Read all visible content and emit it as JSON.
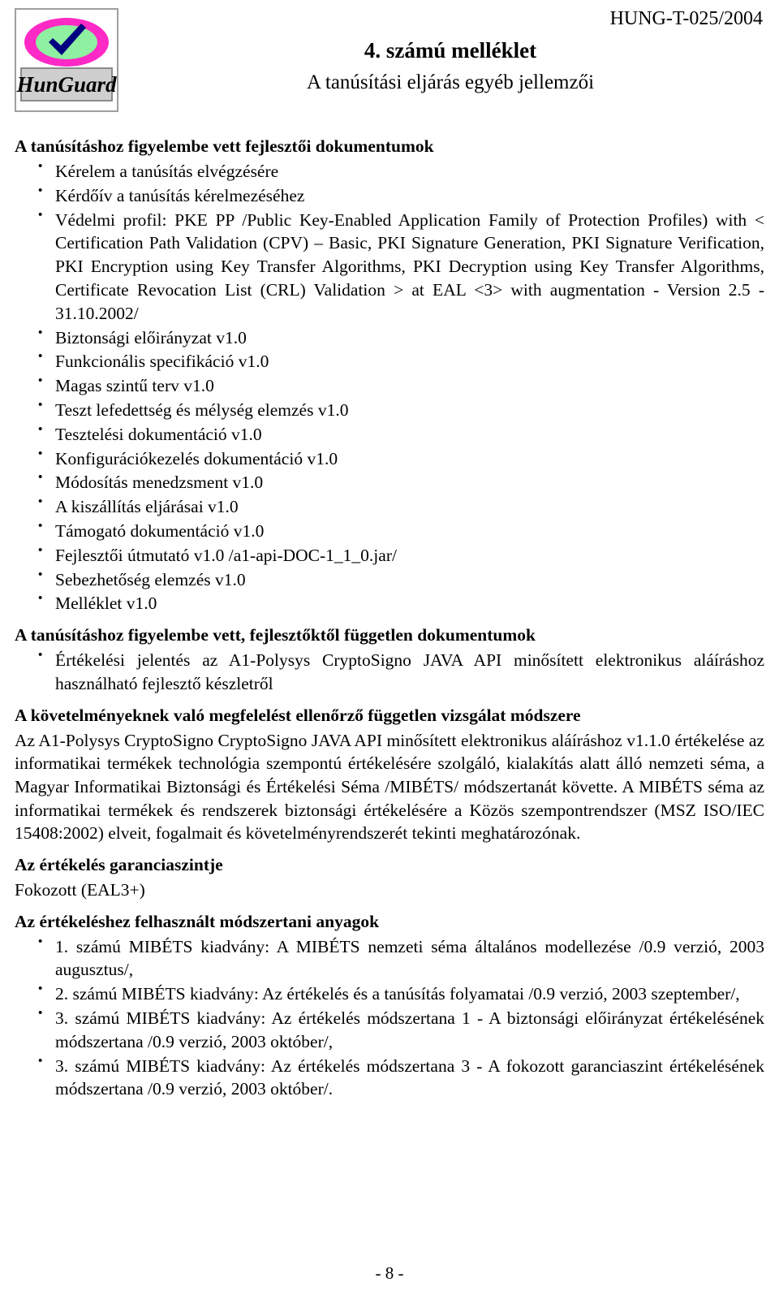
{
  "header": {
    "doc_code": "HUNG-T-025/2004",
    "title_main": "4. számú melléklet",
    "title_sub": "A tanúsítási eljárás egyéb jellemzői",
    "logo_alt": "HunGuard",
    "logo_text": "HunGuard"
  },
  "sections": {
    "dev_docs_heading": "A tanúsításhoz figyelembe vett fejlesztői dokumentumok",
    "dev_docs_items": [
      "Kérelem a tanúsítás elvégzésére",
      "Kérdőív a tanúsítás kérelmezéséhez",
      "Védelmi profil: PKE PP /Public Key-Enabled Application Family of Protection Profiles) with < Certification Path Validation (CPV) – Basic, PKI Signature Generation, PKI Signature Verification, PKI Encryption using Key Transfer Algorithms, PKI Decryption using Key Transfer Algorithms, Certificate Revocation List (CRL) Validation > at EAL <3> with augmentation - Version 2.5 - 31.10.2002/",
      "Biztonsági előirányzat v1.0",
      "Funkcionális specifikáció v1.0",
      "Magas szintű terv v1.0",
      "Teszt lefedettség és mélység elemzés v1.0",
      "Tesztelési dokumentáció v1.0",
      "Konfigurációkezelés dokumentáció v1.0",
      "Módosítás menedzsment v1.0",
      "A kiszállítás eljárásai v1.0",
      "Támogató dokumentáció v1.0",
      "Fejlesztői útmutató v1.0 /a1-api-DOC-1_1_0.jar/",
      "Sebezhetőség elemzés v1.0",
      "Melléklet v1.0"
    ],
    "independent_docs_heading": "A tanúsításhoz figyelembe vett, fejlesztőktől független dokumentumok",
    "independent_docs_items": [
      "Értékelési jelentés az A1-Polysys CryptoSigno JAVA API minősített elektronikus aláíráshoz használható fejlesztő készletről"
    ],
    "method_heading": "A követelményeknek való megfelelést ellenőrző független vizsgálat módszere",
    "method_paragraph": "Az A1-Polysys CryptoSigno CryptoSigno JAVA API minősített elektronikus aláíráshoz v1.1.0 értékelése az informatikai termékek technológia szempontú értékelésére szolgáló, kialakítás alatt álló nemzeti séma, a Magyar Informatikai Biztonsági és Értékelési Séma /MIBÉTS/ módszertanát követte. A MIBÉTS séma az informatikai termékek és rendszerek biztonsági értékelésére a Közös szempontrendszer (MSZ ISO/IEC 15408:2002) elveit, fogalmait és követelményrendszerét tekinti meghatározónak.",
    "assurance_heading": "Az értékelés garanciaszintje",
    "assurance_value": "Fokozott (EAL3+)",
    "materials_heading": "Az értékeléshez felhasznált módszertani anyagok",
    "materials_items": [
      "1. számú MIBÉTS kiadvány: A MIBÉTS nemzeti séma általános modellezése /0.9 verzió, 2003 augusztus/,",
      "2. számú MIBÉTS kiadvány: Az értékelés és a tanúsítás folyamatai /0.9 verzió, 2003 szeptember/,",
      "3. számú MIBÉTS kiadvány: Az értékelés módszertana 1 - A biztonsági előirányzat értékelésének módszertana /0.9 verzió, 2003 október/,",
      "3. számú MIBÉTS kiadvány: Az értékelés módszertana 3 - A fokozott garanciaszint értékelésének módszertana /0.9 verzió, 2003 október/."
    ]
  },
  "footer": {
    "page_number": "- 8 -"
  }
}
